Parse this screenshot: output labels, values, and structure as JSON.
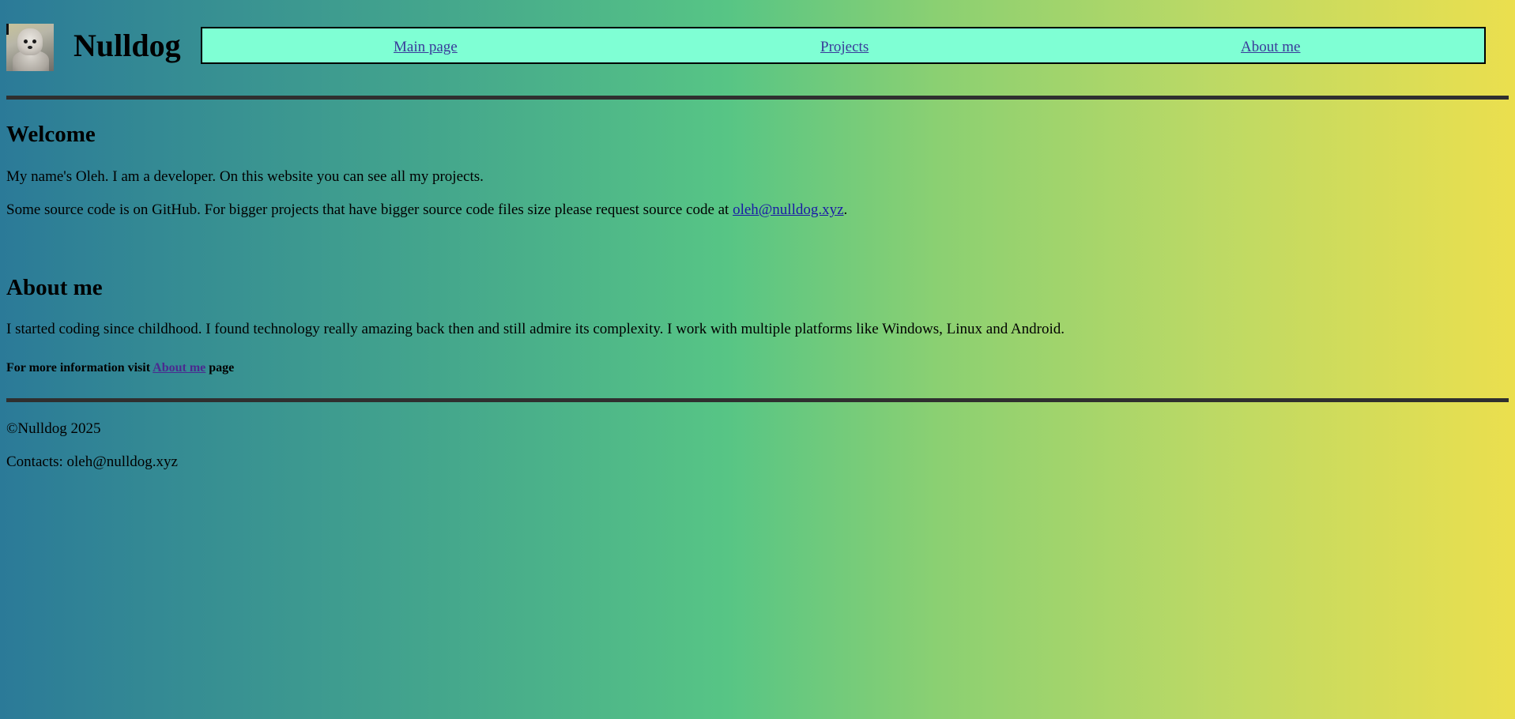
{
  "header": {
    "logo_alt": "dog photo",
    "site_title": "Nulldog"
  },
  "nav": {
    "items": [
      {
        "label": "Main page"
      },
      {
        "label": "Projects"
      },
      {
        "label": "About me"
      }
    ]
  },
  "welcome": {
    "heading": "Welcome",
    "intro": "My name's Oleh. I am a developer. On this website you can see all my projects.",
    "source_text_before": "Some source code is on GitHub. For bigger projects that have bigger source code files size please request source code at ",
    "email_link": "oleh@nulldog.xyz",
    "source_text_after": "."
  },
  "about": {
    "heading": "About me",
    "body": "I started coding since childhood. I found technology really amazing back then and still admire its complexity. I work with multiple platforms like Windows, Linux and Android.",
    "more_before": "For more information visit ",
    "more_link": "About me",
    "more_after": " page"
  },
  "footer": {
    "copyright": "©Nulldog 2025",
    "contacts": "Contacts: oleh@nulldog.xyz"
  },
  "colors": {
    "nav_background": "#7fffd4",
    "rule": "#2f2f2f",
    "link": "#1a1aa6",
    "visited_link": "#4b2a8f"
  }
}
